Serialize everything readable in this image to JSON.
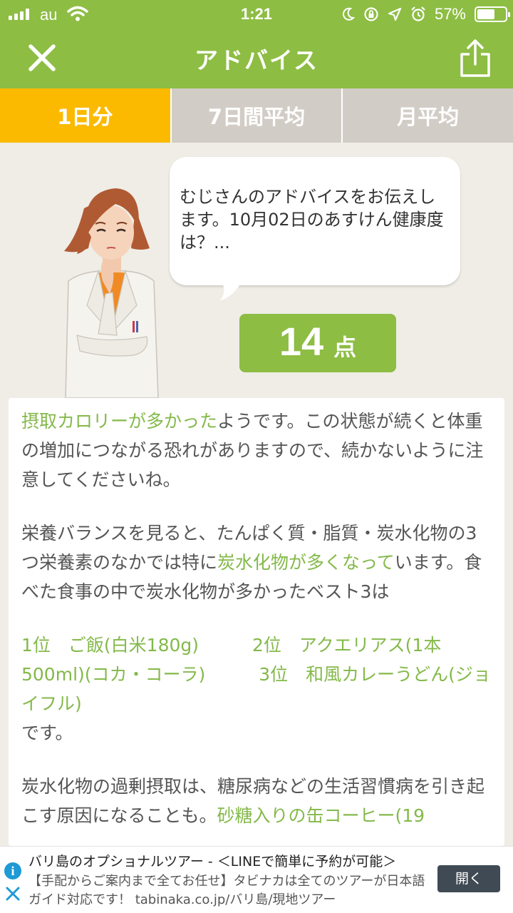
{
  "status_bar": {
    "carrier": "au",
    "time": "1:21",
    "battery": "57%",
    "battery_level": 0.57
  },
  "header": {
    "title": "アドバイス",
    "close_icon": "close-icon",
    "share_icon": "share-icon"
  },
  "tabs": [
    {
      "label": "1日分",
      "active": true
    },
    {
      "label": "7日間平均",
      "active": false
    },
    {
      "label": "月平均",
      "active": false
    }
  ],
  "advice": {
    "bubble_text": "むじさんのアドバイスをお伝えします。10月02日のあすけん健康度は？...",
    "score": "14",
    "score_unit": "点"
  },
  "content": {
    "p1": {
      "highlight": "摂取カロリーが多かった",
      "text": "ようです。この状態が続くと体重の増加につながる恐れがありますので、続かないように注意してくださいね。"
    },
    "p2": {
      "text1": "栄養バランスを見ると、たんぱく質・脂質・炭水化物の3つ栄養素のなかでは特に",
      "highlight": "炭水化物が多くなって",
      "text2": "います。食べた食事の中で炭水化物が多かったベスト3は"
    },
    "p3": {
      "ranking": "1位　ご飯(白米180g)　　　2位　アクエリアス(1本500ml)(コカ・コーラ)　　　3位　和風カレーうどん(ジョイフル)",
      "suffix": "です。"
    },
    "p4": {
      "text": "炭水化物の過剰摂取は、糖尿病などの生活習慣病を引き起こす原因になることも。",
      "highlight": "砂糖入りの缶コーヒー(19"
    }
  },
  "ad": {
    "title": "バリ島のオプショナルツアー - ＜LINEで簡単に予約が可能＞",
    "description": "【手配からご案内まで全てお任せ】タビナカは全てのツアーが日本語ガイド対応です！ tabinaka.co.jp/バリ島/現地ツアー",
    "button": "開く"
  },
  "colors": {
    "brand_green": "#8dbd43",
    "tab_active": "#fbba00",
    "tab_inactive": "#d2ccc6",
    "highlight_text": "#84b94a"
  }
}
